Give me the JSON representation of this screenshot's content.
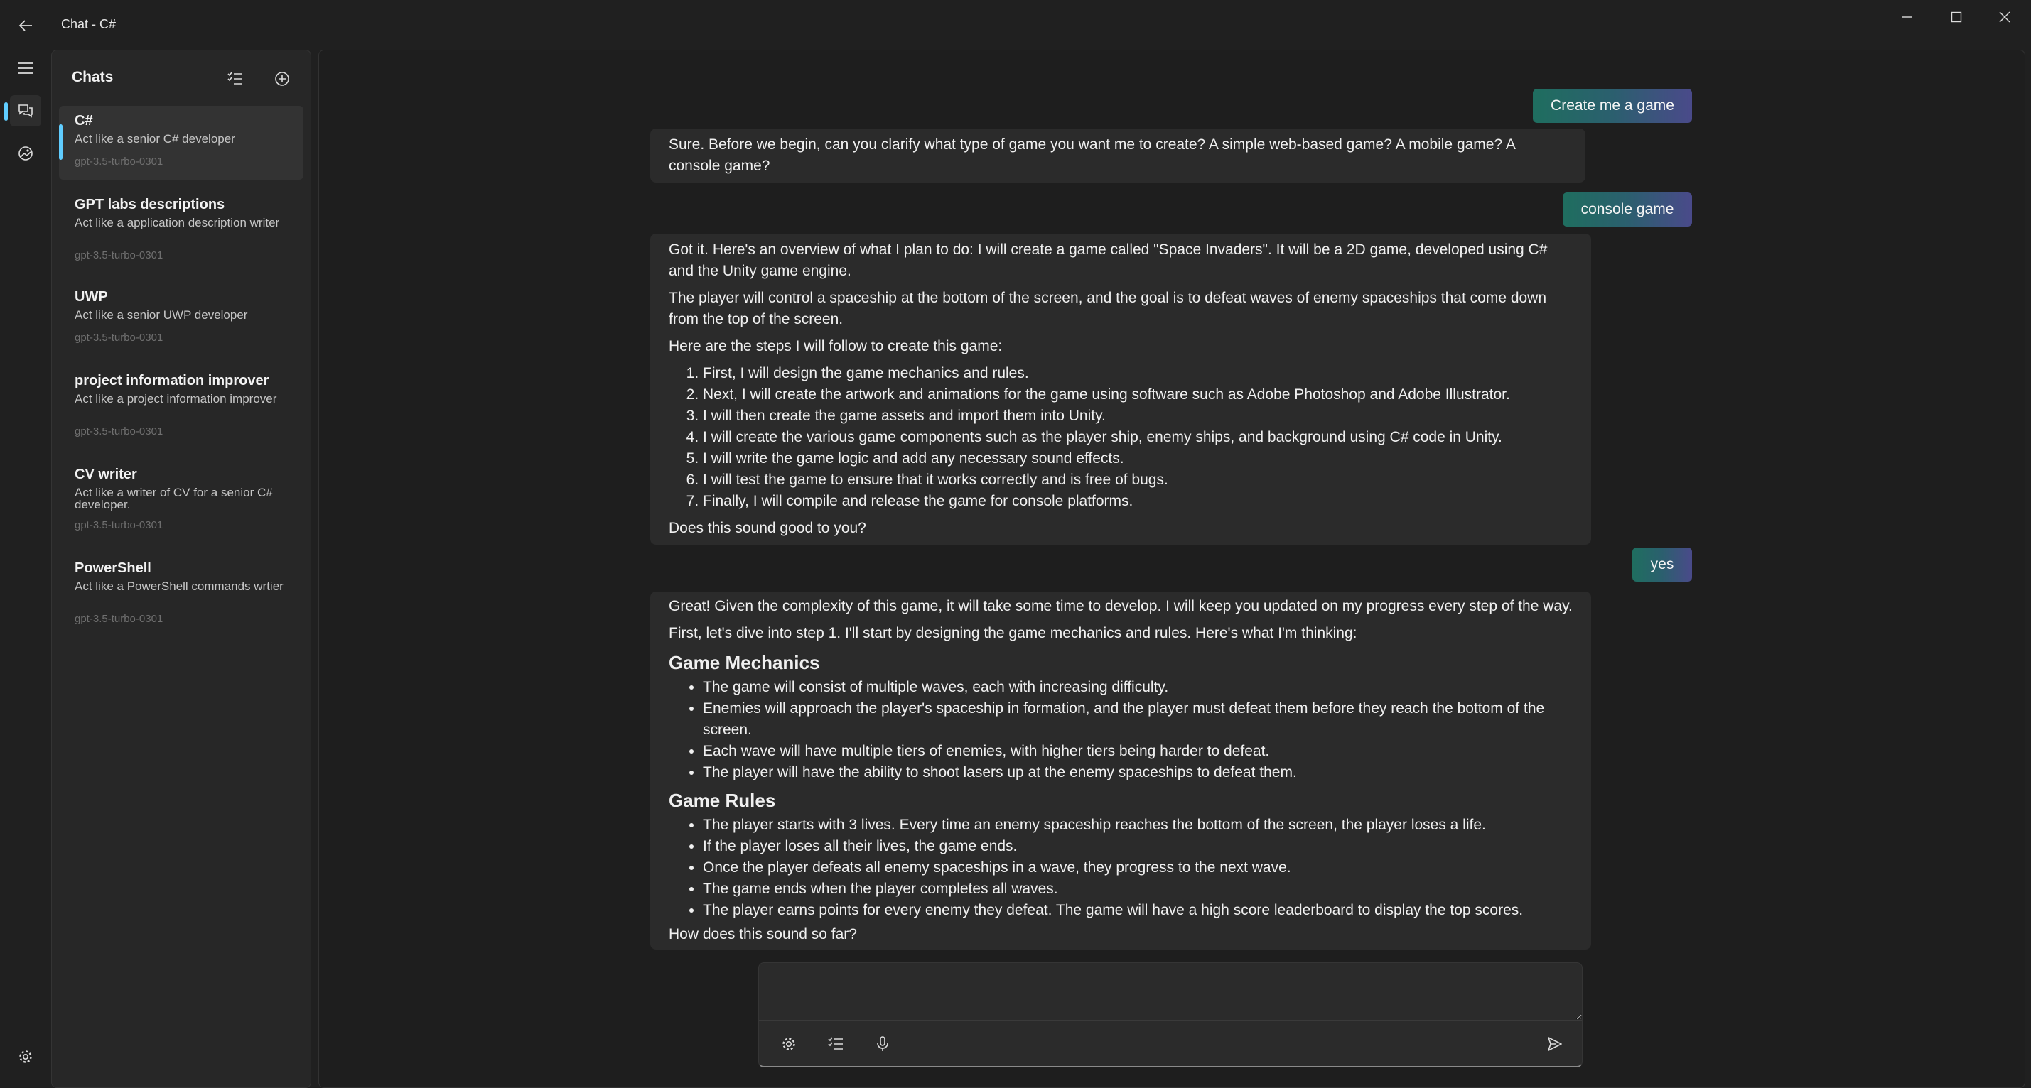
{
  "window": {
    "title": "Chat - C#"
  },
  "sidebar": {
    "title": "Chats",
    "chats": [
      {
        "name": "C#",
        "description": "Act like a senior C# developer",
        "model": "gpt-3.5-turbo-0301"
      },
      {
        "name": "GPT labs descriptions",
        "description": "Act like a application description writer",
        "model": "gpt-3.5-turbo-0301"
      },
      {
        "name": "UWP",
        "description": "Act like a senior UWP developer",
        "model": "gpt-3.5-turbo-0301"
      },
      {
        "name": "project information improver",
        "description": "Act like a project information improver",
        "model": "gpt-3.5-turbo-0301"
      },
      {
        "name": "CV writer",
        "description": "Act like a writer of CV for a senior C# developer.",
        "model": "gpt-3.5-turbo-0301"
      },
      {
        "name": "PowerShell",
        "description": "Act like a PowerShell commands wrtier",
        "model": "gpt-3.5-turbo-0301"
      }
    ]
  },
  "conversation": {
    "user1": "Create me a game",
    "bot1": "Sure. Before we begin, can you clarify what type of game you want me to create? A simple web-based game? A mobile game? A console game?",
    "user2": "console game",
    "bot2": {
      "intro": "Got it. Here's an overview of what I plan to do: I will create a game called \"Space Invaders\". It will be a 2D game, developed using C# and the Unity game engine.",
      "goal": "The player will control a spaceship at the bottom of the screen, and the goal is to defeat waves of enemy spaceships that come down from the top of the screen.",
      "steps_intro": "Here are the steps I will follow to create this game:",
      "steps": [
        "First, I will design the game mechanics and rules.",
        "Next, I will create the artwork and animations for the game using software such as Adobe Photoshop and Adobe Illustrator.",
        "I will then create the game assets and import them into Unity.",
        "I will create the various game components such as the player ship, enemy ships, and background using C# code in Unity.",
        "I will write the game logic and add any necessary sound effects.",
        "I will test the game to ensure that it works correctly and is free of bugs.",
        "Finally, I will compile and release the game for console platforms."
      ],
      "closing": "Does this sound good to you?"
    },
    "user3": "yes",
    "bot3": {
      "p1": "Great! Given the complexity of this game, it will take some time to develop. I will keep you updated on my progress every step of the way.",
      "p2": "First, let's dive into step 1. I'll start by designing the game mechanics and rules. Here's what I'm thinking:",
      "h_mechanics": "Game Mechanics",
      "mechanics": [
        "The game will consist of multiple waves, each with increasing difficulty.",
        "Enemies will approach the player's spaceship in formation, and the player must defeat them before they reach the bottom of the screen.",
        "Each wave will have multiple tiers of enemies, with higher tiers being harder to defeat.",
        "The player will have the ability to shoot lasers up at the enemy spaceships to defeat them."
      ],
      "h_rules": "Game Rules",
      "rules": [
        "The player starts with 3 lives. Every time an enemy spaceship reaches the bottom of the screen, the player loses a life.",
        "If the player loses all their lives, the game ends.",
        "Once the player defeats all enemy spaceships in a wave, they progress to the next wave.",
        "The game ends when the player completes all waves.",
        "The player earns points for every enemy they defeat. The game will have a high score leaderboard to display the top scores."
      ],
      "closing": "How does this sound so far?"
    }
  },
  "input": {
    "value": "",
    "placeholder": ""
  },
  "colors": {
    "accent": "#60cdff",
    "background": "#202020",
    "bubble": "#2b2b2b"
  }
}
